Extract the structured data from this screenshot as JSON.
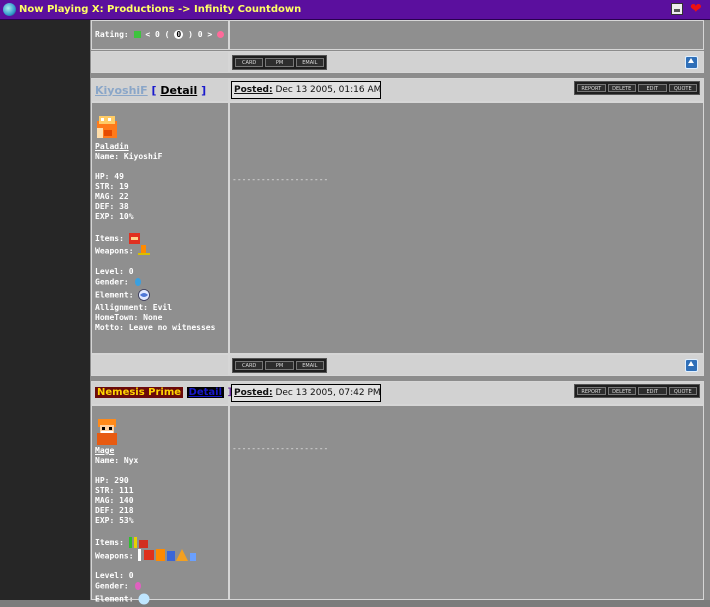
{
  "window": {
    "title": "Now Playing X: Productions -> Infinity Countdown"
  },
  "colors": {
    "titlebar_bg": "#5b0f9e",
    "titlebar_text": "#ffff66",
    "page_bg": "#7c7c7c",
    "left_column": "#262626"
  },
  "rating": {
    "label": "Rating:",
    "lt": "< 0 (",
    "zero": "0",
    "gt": ") 0 >"
  },
  "post_buttons": {
    "card": "CARD",
    "pm": "PM",
    "email": "EMAIL"
  },
  "post_actions": {
    "report": "REPORT",
    "delete": "DELETE",
    "edit": "EDIT",
    "quote": "QUOTE"
  },
  "posts": [
    {
      "username": "KiyoshiF",
      "detail_open": "[",
      "detail_label": "Detail",
      "detail_close": "]",
      "posted_label": "Posted:",
      "posted_date": "Dec 13 2005, 01:16 AM",
      "class": "Paladin",
      "name_line": "Name: KiyoshiF",
      "hp": "HP: 49",
      "str": "STR: 19",
      "mag": "MAG: 22",
      "def": "DEF: 38",
      "exp": "EXP: 10%",
      "items_label": "Items:",
      "weapons_label": "Weapons:",
      "level": "Level: 0",
      "gender_label": "Gender:",
      "element_label": "Element:",
      "allignment": "Allignment: Evil",
      "hometown": "HomeTown: None",
      "motto": "Motto: Leave no witnesses",
      "signature": "--------------------"
    },
    {
      "username": "Nemesis Prime",
      "detail_label": "Detail",
      "detail_close": "]",
      "posted_label": "Posted:",
      "posted_date": "Dec 13 2005, 07:42 PM",
      "class": "Mage",
      "name_line": "Name: Nyx",
      "hp": "HP: 290",
      "str": "STR: 111",
      "mag": "MAG: 140",
      "def": "DEF: 218",
      "exp": "EXP: 53%",
      "items_label": "Items:",
      "weapons_label": "Weapons:",
      "level": "Level: 0",
      "gender_label": "Gender:",
      "element_label": "Element:",
      "signature": "--------------------"
    }
  ],
  "icons": [
    "browser-icon",
    "print-icon",
    "heart-icon",
    "scroll-top-icon",
    "paladin-sprite",
    "mage-sprite",
    "item-icon",
    "weapon-icon",
    "gender-icon",
    "element-icon"
  ]
}
